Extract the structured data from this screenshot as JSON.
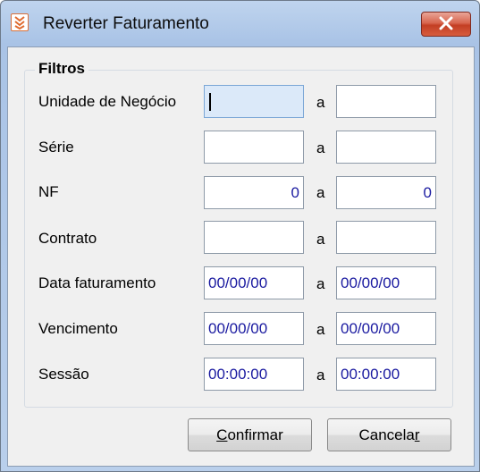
{
  "window": {
    "title": "Reverter Faturamento",
    "close_icon": "close-icon"
  },
  "filters": {
    "group_label": "Filtros",
    "range_separator": "a",
    "rows": [
      {
        "label": "Unidade de Negócio",
        "from": "",
        "to": ""
      },
      {
        "label": "Série",
        "from": "",
        "to": ""
      },
      {
        "label": "NF",
        "from": "0",
        "to": "0"
      },
      {
        "label": "Contrato",
        "from": "",
        "to": ""
      },
      {
        "label": "Data faturamento",
        "from": "00/00/00",
        "to": "00/00/00"
      },
      {
        "label": "Vencimento",
        "from": "00/00/00",
        "to": "00/00/00"
      },
      {
        "label": "Sessão",
        "from": "00:00:00",
        "to": "00:00:00"
      }
    ]
  },
  "buttons": {
    "confirm": {
      "accel": "C",
      "rest": "onfirmar"
    },
    "cancel": {
      "pre": "Cancela",
      "accel": "r"
    }
  },
  "colors": {
    "title_bar": "#a9c3e6",
    "close_button": "#c33f24",
    "field_value": "#1a1aa0",
    "focused_field": "#dbe9f9"
  }
}
